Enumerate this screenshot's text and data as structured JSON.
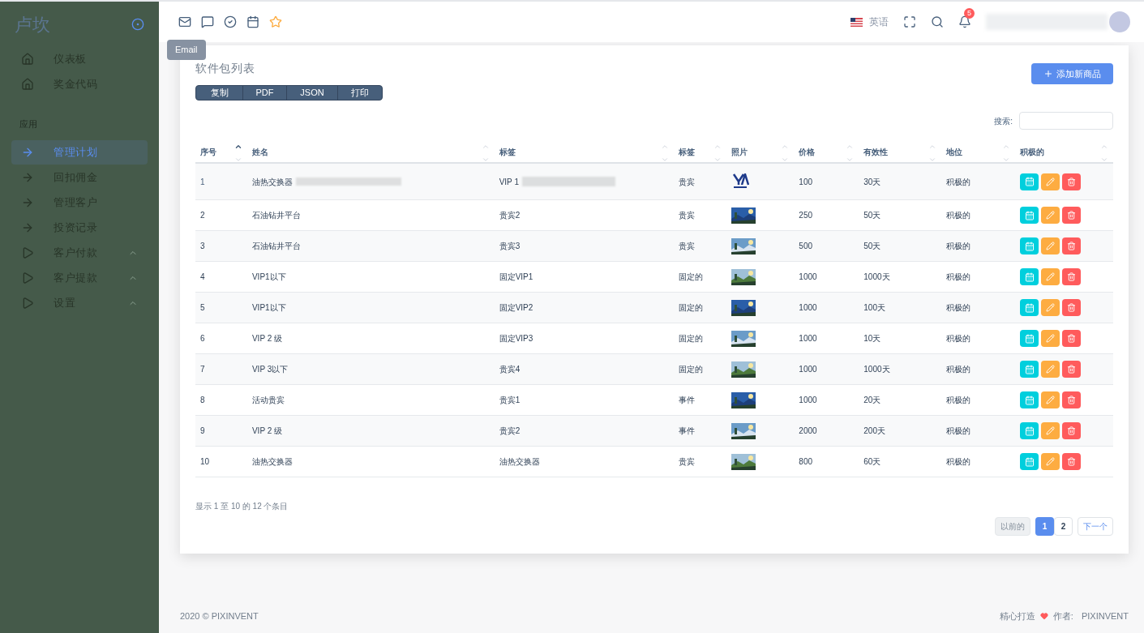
{
  "sidebar": {
    "logo": "卢坎",
    "items": [
      {
        "label": "仪表板",
        "kind": "home",
        "selected": false
      },
      {
        "label": "奖金代码",
        "kind": "home",
        "selected": false
      },
      {
        "label": "应用",
        "kind": "section"
      },
      {
        "label": "管理计划",
        "kind": "link",
        "selected": true
      },
      {
        "label": "回扣佣金",
        "kind": "link",
        "selected": false
      },
      {
        "label": "管理客户",
        "kind": "link",
        "selected": false
      },
      {
        "label": "投资记录",
        "kind": "link",
        "selected": false
      },
      {
        "label": "客户付款",
        "kind": "group",
        "selected": false
      },
      {
        "label": "客户提款",
        "kind": "group",
        "selected": false
      },
      {
        "label": "设置",
        "kind": "group",
        "selected": false
      }
    ]
  },
  "navbar": {
    "tooltip": "Email",
    "language": "英语",
    "notifications": "5"
  },
  "card": {
    "title": "软件包列表",
    "export_buttons": [
      "复制",
      "PDF",
      "JSON",
      "打印"
    ],
    "add_button": "添加新商品",
    "search_label": "搜索:",
    "columns": [
      {
        "label": "序号",
        "sorted": true
      },
      {
        "label": "姓名",
        "sorted": false
      },
      {
        "label": "标签",
        "sorted": false
      },
      {
        "label": "标签",
        "sorted": false
      },
      {
        "label": "照片",
        "sorted": false
      },
      {
        "label": "价格",
        "sorted": false
      },
      {
        "label": "有效性",
        "sorted": false
      },
      {
        "label": "地位",
        "sorted": false
      },
      {
        "label": "积极的",
        "sorted": false
      }
    ],
    "rows": [
      {
        "no": "1",
        "name": "油热交换器",
        "tag": "VIP 1",
        "tag_2": "贵宾",
        "photo": {
          "kind": "logo"
        },
        "price": "100",
        "validity": "30天",
        "status": "积极的",
        "redacted": true
      },
      {
        "no": "2",
        "name": "石油钻井平台",
        "tag": "贵宾2",
        "tag_2": "贵宾",
        "price": "250",
        "validity": "50天",
        "status": "积极的",
        "redacted": false
      },
      {
        "no": "3",
        "name": "石油钻井平台",
        "tag": "贵宾3",
        "tag_2": "贵宾",
        "price": "500",
        "validity": "50天",
        "status": "积极的",
        "redacted": false
      },
      {
        "no": "4",
        "name": "VIP1以下",
        "tag": "固定VIP1",
        "tag_2": "固定的",
        "price": "1000",
        "validity": "1000天",
        "status": "积极的",
        "redacted": false
      },
      {
        "no": "5",
        "name": "VIP1以下",
        "tag": "固定VIP2",
        "tag_2": "固定的",
        "price": "1000",
        "validity": "100天",
        "status": "积极的",
        "redacted": false
      },
      {
        "no": "6",
        "name": "VIP 2 级",
        "tag": "固定VIP3",
        "tag_2": "固定的",
        "price": "1000",
        "validity": "10天",
        "status": "积极的",
        "redacted": false
      },
      {
        "no": "7",
        "name": "VIP 3以下",
        "tag": "贵宾4",
        "tag_2": "固定的",
        "price": "1000",
        "validity": "1000天",
        "status": "积极的",
        "redacted": false
      },
      {
        "no": "8",
        "name": "活动贵宾",
        "tag": "贵宾1",
        "tag_2": "事件",
        "price": "1000",
        "validity": "20天",
        "status": "积极的",
        "redacted": false
      },
      {
        "no": "9",
        "name": "VIP 2 级",
        "tag": "贵宾2",
        "tag_2": "事件",
        "price": "2000",
        "validity": "200天",
        "status": "积极的",
        "redacted": false
      },
      {
        "no": "10",
        "name": "油热交换器",
        "tag": "油热交换器",
        "tag_2": "贵宾",
        "price": "800",
        "validity": "60天",
        "status": "积极的",
        "redacted": false
      }
    ],
    "info": "显示 1 至 10 的 12 个条目",
    "pagination": {
      "previous": {
        "label": "以前的",
        "disabled": true
      },
      "pages": [
        {
          "label": "1",
          "selected": true
        },
        {
          "label": "2",
          "selected": false
        }
      ],
      "next": {
        "label": "下一个",
        "disabled": false
      }
    }
  },
  "footer": {
    "copyright": "2020 © PIXINVENT",
    "credit_left": "精心打造",
    "credit_right": "作者:",
    "author": "PIXINVENT"
  }
}
